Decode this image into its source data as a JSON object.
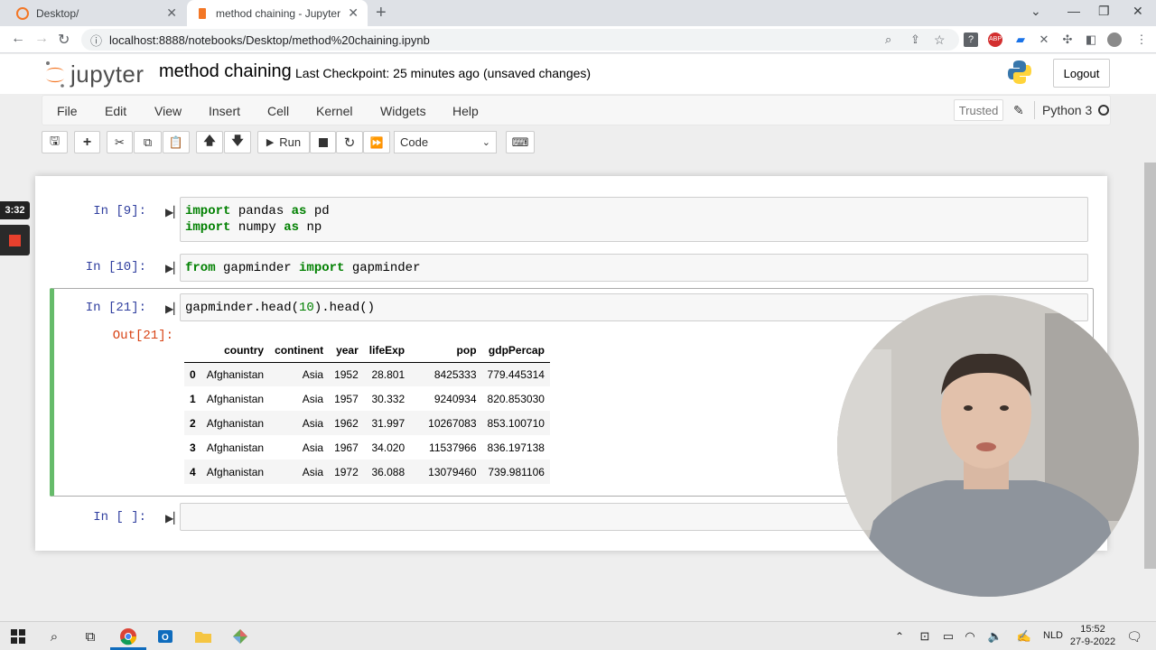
{
  "browser": {
    "tabs": [
      {
        "title": "Desktop/",
        "active": false
      },
      {
        "title": "method chaining - Jupyter Notel",
        "active": true
      }
    ],
    "url": "localhost:8888/notebooks/Desktop/method%20chaining.ipynb"
  },
  "jupyter": {
    "logo_text": "jupyter",
    "notebook_name": "method chaining",
    "checkpoint": "Last Checkpoint: 25 minutes ago",
    "save_status": "(unsaved changes)",
    "logout_label": "Logout",
    "menu": [
      "File",
      "Edit",
      "View",
      "Insert",
      "Cell",
      "Kernel",
      "Widgets",
      "Help"
    ],
    "trusted_label": "Trusted",
    "kernel_name": "Python 3",
    "toolbar": {
      "run_label": "Run",
      "cell_type": "Code"
    }
  },
  "cells": [
    {
      "prompt": "In [9]:",
      "lines": [
        [
          "import",
          " pandas ",
          "as",
          " pd"
        ],
        [
          "import",
          " numpy ",
          "as",
          " np"
        ]
      ]
    },
    {
      "prompt": "In [10]:",
      "line": [
        "from",
        " gapminder ",
        "import",
        " gapminder"
      ]
    },
    {
      "prompt": "In [21]:",
      "code_a": "gapminder.head(",
      "code_num": "10",
      "code_b": ").head()",
      "out_prompt": "Out[21]:"
    },
    {
      "prompt": "In [ ]:"
    }
  ],
  "dataframe": {
    "columns": [
      "country",
      "continent",
      "year",
      "lifeExp",
      "pop",
      "gdpPercap"
    ],
    "rows": [
      [
        "0",
        "Afghanistan",
        "Asia",
        "1952",
        "28.801",
        "8425333",
        "779.445314"
      ],
      [
        "1",
        "Afghanistan",
        "Asia",
        "1957",
        "30.332",
        "9240934",
        "820.853030"
      ],
      [
        "2",
        "Afghanistan",
        "Asia",
        "1962",
        "31.997",
        "10267083",
        "853.100710"
      ],
      [
        "3",
        "Afghanistan",
        "Asia",
        "1967",
        "34.020",
        "11537966",
        "836.197138"
      ],
      [
        "4",
        "Afghanistan",
        "Asia",
        "1972",
        "36.088",
        "13079460",
        "739.981106"
      ]
    ]
  },
  "recording": {
    "timer": "3:32"
  },
  "taskbar": {
    "language": "NLD",
    "time": "15:52",
    "date": "27-9-2022"
  },
  "colors": {
    "prompt_in": "#303f9f",
    "prompt_out": "#d84315",
    "keyword": "#008000",
    "selected_cell_bar": "#66bb6a",
    "jupyter_orange": "#f37726"
  }
}
